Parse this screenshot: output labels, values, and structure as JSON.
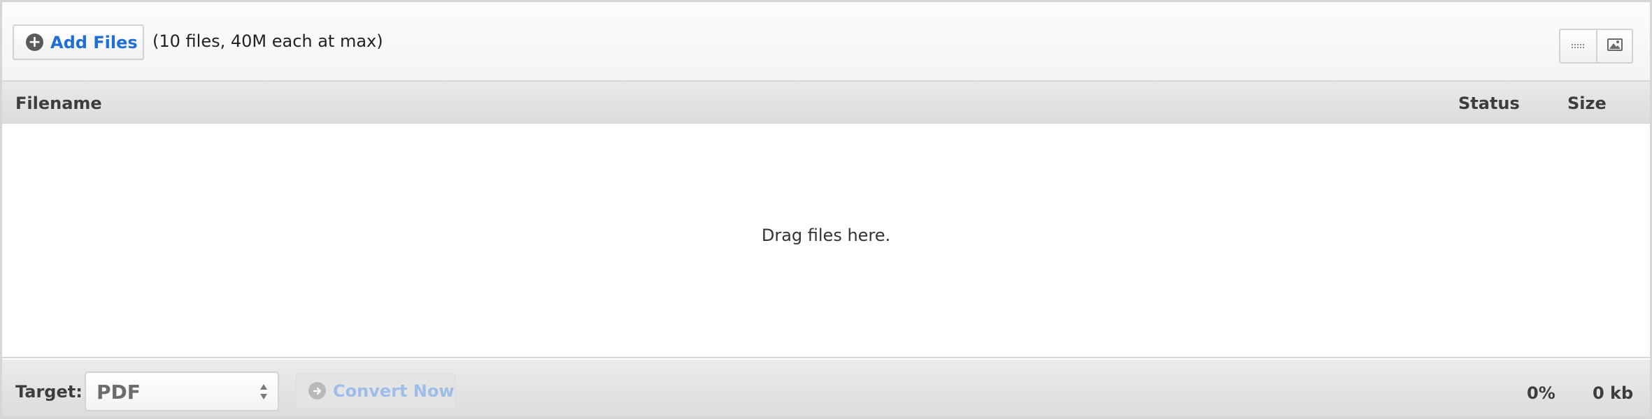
{
  "header": {
    "add_files_label": "Add Files",
    "add_files_icon": "plus-circle-icon",
    "limits_text": "(10 files, 40M each at max)",
    "view_buttons": [
      {
        "name": "list-view",
        "icon": "list-icon"
      },
      {
        "name": "thumbnail-view",
        "icon": "image-icon"
      }
    ]
  },
  "columns": {
    "filename": "Filename",
    "status": "Status",
    "size": "Size"
  },
  "dropzone": {
    "message": "Drag files here."
  },
  "footer": {
    "target_label": "Target:",
    "target_value": "PDF",
    "convert_label": "Convert Now",
    "convert_icon": "arrow-right-circle-icon",
    "progress_percent": "0%",
    "total_size": "0 kb"
  },
  "colors": {
    "accent": "#1f6fd4",
    "disabled_text": "#9fbde8"
  }
}
